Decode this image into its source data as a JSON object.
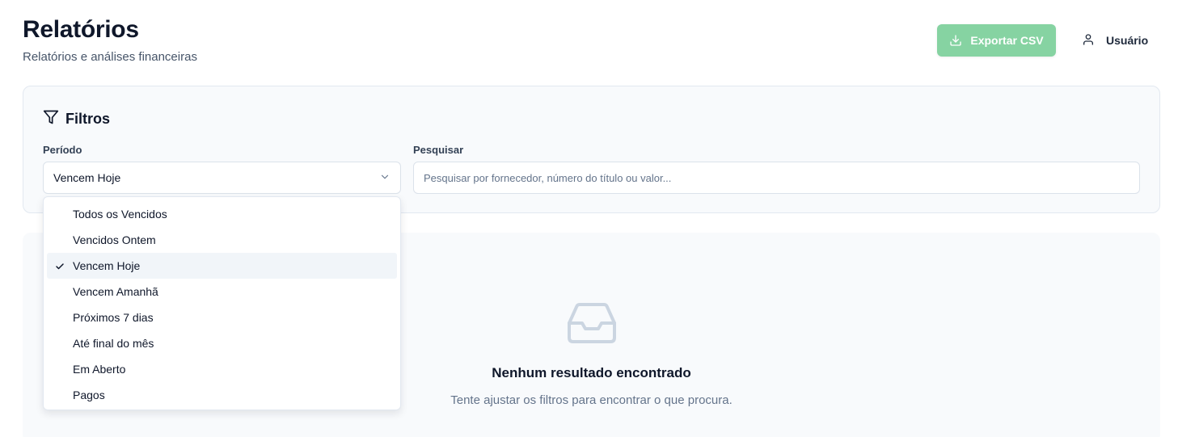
{
  "header": {
    "title": "Relatórios",
    "subtitle": "Relatórios e análises financeiras",
    "export_label": "Exportar CSV",
    "user_label": "Usuário"
  },
  "filters": {
    "heading": "Filtros",
    "period_label": "Período",
    "period_value": "Vencem Hoje",
    "search_label": "Pesquisar",
    "search_placeholder": "Pesquisar por fornecedor, número do título ou valor..."
  },
  "dropdown": {
    "options": [
      "Todos os Vencidos",
      "Vencidos Ontem",
      "Vencem Hoje",
      "Vencem Amanhã",
      "Próximos 7 dias",
      "Até final do mês",
      "Em Aberto",
      "Pagos"
    ],
    "selected_option": "Vencem Hoje"
  },
  "empty_state": {
    "title": "Nenhum resultado encontrado",
    "message": "Tente ajustar os filtros para encontrar o que procura."
  },
  "colors": {
    "export_button": "#86d3a2",
    "panel_background": "#f8fafc"
  },
  "icons": {
    "export": "download-icon",
    "user": "user-icon",
    "filter": "filter-icon",
    "select": "chevron-down-icon",
    "selected": "check-icon",
    "empty": "inbox-icon"
  }
}
